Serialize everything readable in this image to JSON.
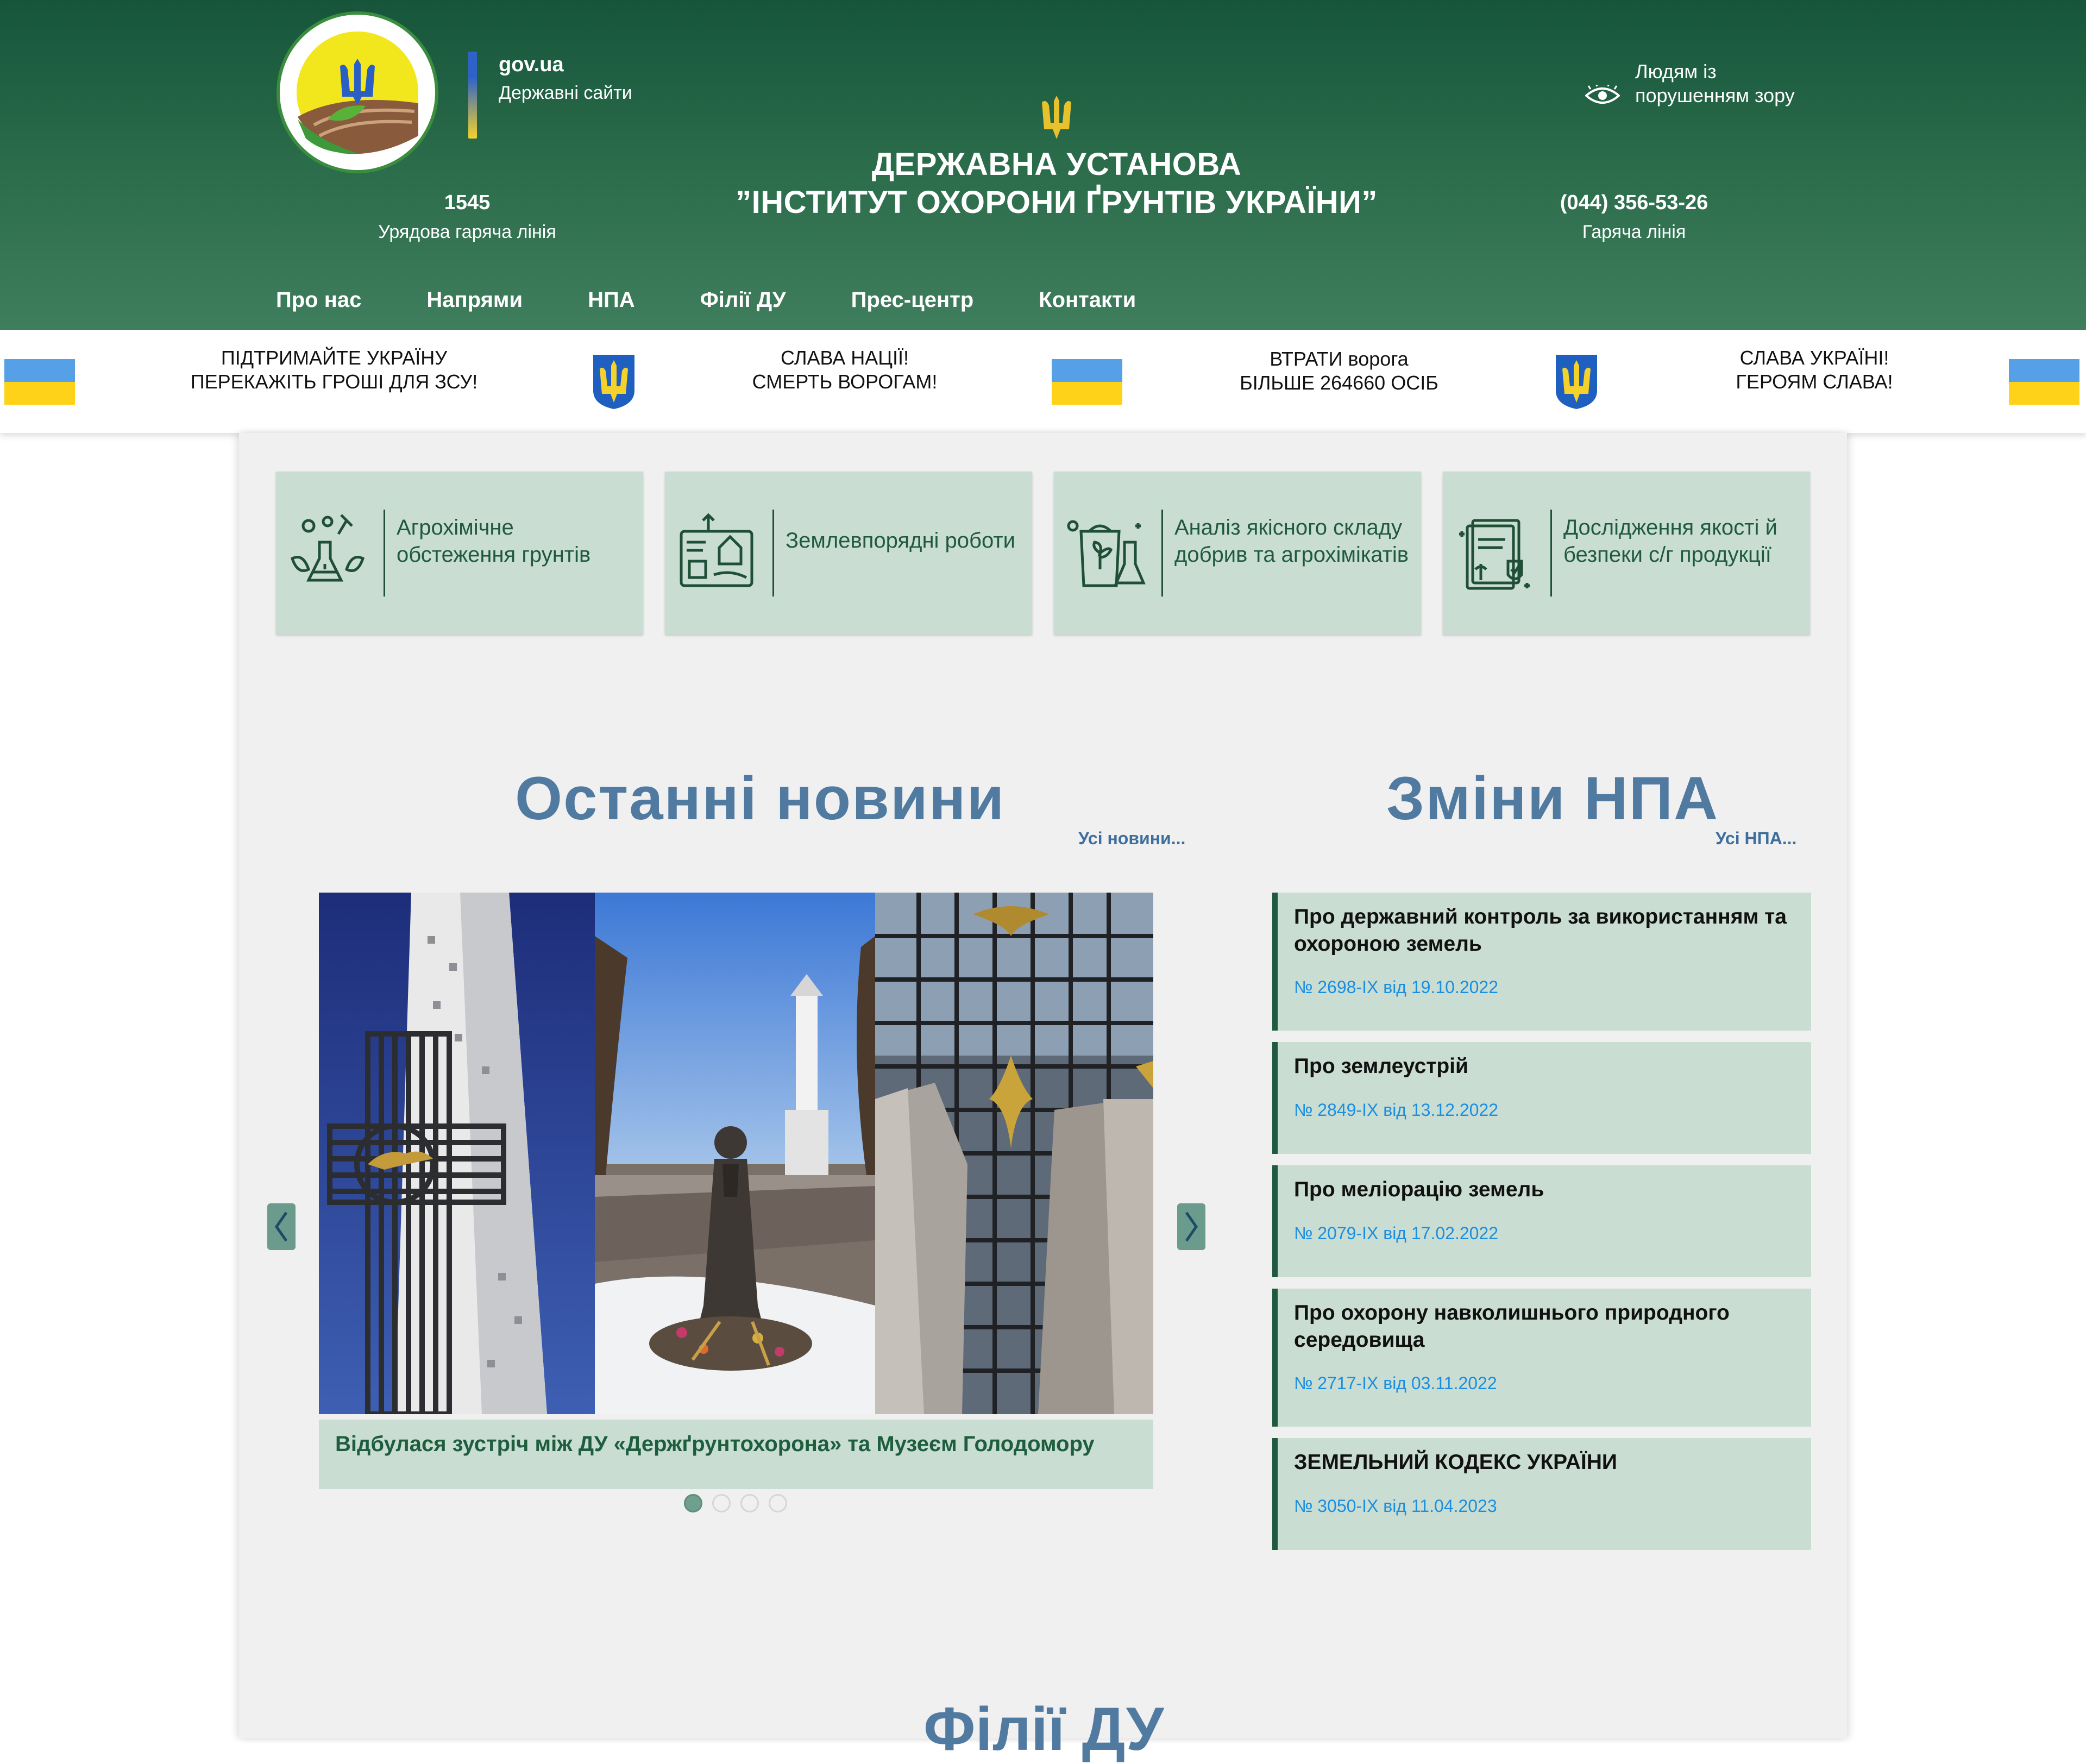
{
  "header": {
    "gov_title": "gov.ua",
    "gov_sub": "Державні сайти",
    "org_title_line1": "ДЕРЖАВНА УСТАНОВА",
    "org_title_line2": "”ІНСТИТУТ ОХОРОНИ ҐРУНТІВ УКРАЇНИ”",
    "hotline_left_num": "1545",
    "hotline_left_label": "Урядова гаряча лінія",
    "hotline_right_num": "(044) 356-53-26",
    "hotline_right_label": "Гаряча лінія",
    "vision_line1": "Людям із",
    "vision_line2": "порушенням зору",
    "logo_text": "ДЕРЖАВНА УСТАНОВА “ІНСТИТУТ ОХОРОНИ ҐРУНТІВ УКРАЇНИ”"
  },
  "nav": {
    "items": [
      "Про нас",
      "Напрями",
      "НПА",
      "Філії ДУ",
      "Прес-центр",
      "Контакти"
    ]
  },
  "banner": {
    "items": [
      {
        "line1": "ПІДТРИМАЙТЕ УКРАЇНУ",
        "line2": "ПЕРЕКАЖІТЬ ГРОШІ ДЛЯ ЗСУ!"
      },
      {
        "line1": "СЛАВА НАЦІЇ!",
        "line2": "СМЕРТЬ ВОРОГАМ!"
      },
      {
        "line1": "ВТРАТИ ворога",
        "line2": "БІЛЬШЕ 264660 ОСІБ"
      },
      {
        "line1": "СЛАВА УКРАЇНІ!",
        "line2": "ГЕРОЯМ СЛАВА!"
      }
    ],
    "flag_colors": {
      "blue": "#55a0e6",
      "yellow": "#ffd21a"
    }
  },
  "services": [
    {
      "line1": "Агрохімічне",
      "line2": "обстеження грунтів",
      "icon": "soil-lab-icon"
    },
    {
      "line1": "Землевпорядні роботи",
      "line2": "",
      "icon": "land-map-icon"
    },
    {
      "line1": "Аналіз якісного складу",
      "line2": "добрив та агрохімікатів",
      "icon": "fertilizer-icon"
    },
    {
      "line1": "Дослідження якості й",
      "line2": "безпеки с/г продукції",
      "icon": "quality-document-icon"
    }
  ],
  "news": {
    "title": "Останні новини",
    "all_link": "Усі новини...",
    "caption": "Відбулася зустріч між ДУ «Держґрунтохорона» та Музеєм Голодомору",
    "slides_total": 4,
    "active_slide": 1
  },
  "npa": {
    "title": "Зміни НПА",
    "all_link": "Усі НПА...",
    "items": [
      {
        "title": "Про державний контроль за використанням та охороною земель",
        "ref": "№ 2698-IX від 19.10.2022"
      },
      {
        "title": "Про землеустрій",
        "ref": "№ 2849-IX від 13.12.2022"
      },
      {
        "title": "Про меліорацію земель",
        "ref": "№ 2079-IX від 17.02.2022"
      },
      {
        "title": "Про охорону навколишнього природного середовища",
        "ref": "№ 2717-IX від 03.11.2022"
      },
      {
        "title": "ЗЕМЕЛЬНИЙ КОДЕКС УКРАЇНИ",
        "ref": "№ 3050-IX від 11.04.2023"
      }
    ]
  },
  "branches": {
    "title": "Філії ДУ"
  },
  "colors": {
    "header_green": "#16553a",
    "card_green": "#c9ddd2",
    "title_blue": "#517aa0",
    "link_blue": "#1b8ee0",
    "accent_yellow": "#f4d22b"
  }
}
